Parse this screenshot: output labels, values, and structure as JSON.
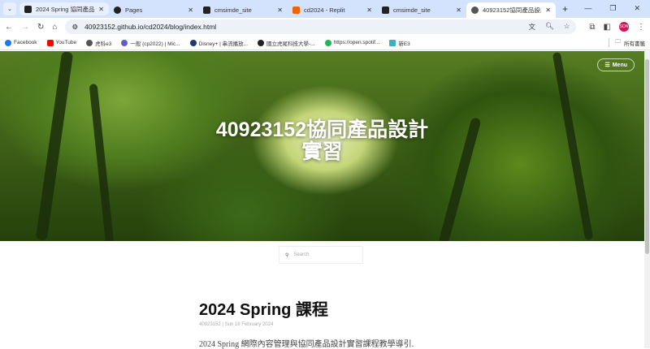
{
  "browser": {
    "tabs": [
      {
        "label": "2024 Spring 協同產品設計"
      },
      {
        "label": "Pages"
      },
      {
        "label": "cmsimde_site"
      },
      {
        "label": "cd2024 - Replit"
      },
      {
        "label": "cmsimde_site"
      },
      {
        "label": "40923152協同產品設計實"
      }
    ],
    "url": "40923152.github.io/cd2024/blog/index.html",
    "profile": "SON",
    "bookmarks": [
      "Facebook",
      "YouTube",
      "虎科e3",
      "一般 (cp2022) | Mic...",
      "Disney+ | 串流播放...",
      "國立虎尾科技大學-...",
      "https://open.spotif...",
      "新E3"
    ],
    "all_bookmarks": "所有書籤"
  },
  "page": {
    "hero_title_line1": "40923152協同產品設計",
    "hero_title_line2": "實習",
    "menu_label": "Menu",
    "search_placeholder": "Search",
    "post": {
      "title": "2024 Spring 課程",
      "meta": "40923152 | Sun 18 February 2024",
      "excerpt": "2024 Spring 網際內容管理與協同產品設計實習課程教學導引."
    }
  }
}
